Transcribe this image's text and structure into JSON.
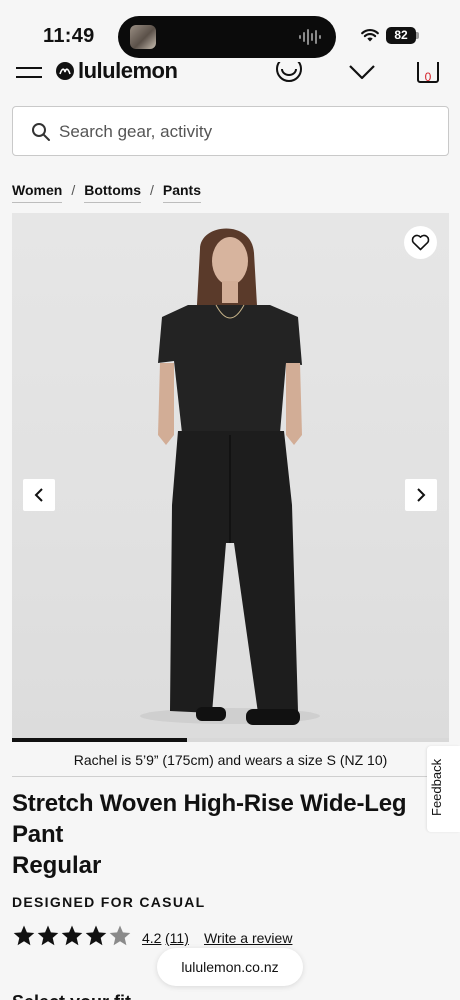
{
  "status_bar": {
    "time": "11:49",
    "battery": "82",
    "icons": [
      "island-media-thumbnail",
      "audio-waveform-icon",
      "wifi-icon",
      "battery-icon"
    ]
  },
  "header": {
    "brand": "lululemon",
    "bag_count": "0",
    "icons": [
      "menu-icon",
      "lululemon-logo-icon",
      "account-icon",
      "heart-icon",
      "bag-icon"
    ]
  },
  "search": {
    "placeholder": "Search gear, activity"
  },
  "breadcrumb": [
    "Women",
    "Bottoms",
    "Pants"
  ],
  "product": {
    "image_index_fraction": 0.4,
    "model_caption": "Rachel is 5’9” (175cm) and wears a size S (NZ 10)",
    "title": "Stretch Woven High-Rise Wide-Leg Pant",
    "fit": "Regular",
    "designed_for": "DESIGNED FOR CASUAL",
    "rating": {
      "stars": 4.2,
      "value": "4.2",
      "count": "(11)",
      "write_review": "Write a review"
    },
    "next_section_partial": "Select your fit"
  },
  "feedback_tab": "Feedback",
  "browser": {
    "url": "lululemon.co.nz"
  },
  "colors": {
    "background": "#f6f6f6",
    "text": "#111111",
    "bag_count": "#d31f26",
    "star": "#111111",
    "star_empty": "#8a8a8a"
  }
}
